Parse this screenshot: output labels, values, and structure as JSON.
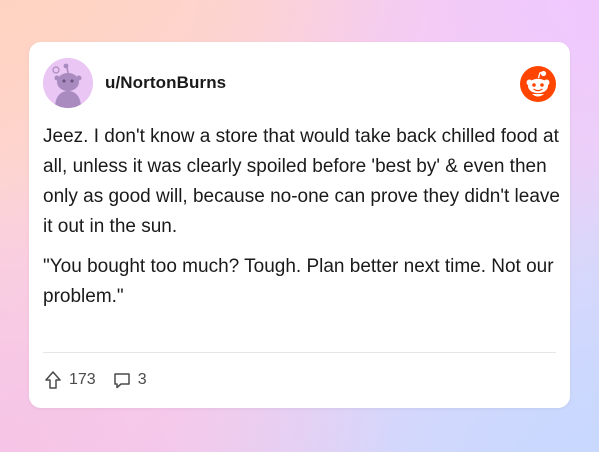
{
  "post": {
    "username": "u/NortonBurns",
    "paragraphs": [
      "Jeez. I don't know a store that would take back chilled food at all, unless it was clearly spoiled before 'best by' & even then only as good will, because no-one can prove they didn't leave it out in the sun.",
      "\"You bought too much? Tough. Plan better next time. Not our problem.\""
    ],
    "upvotes": "173",
    "comments": "3"
  },
  "icons": {
    "avatar": "snoo-avatar-icon",
    "logo": "reddit-logo-icon",
    "upvote": "upvote-arrow-icon",
    "comment": "comment-bubble-icon"
  },
  "colors": {
    "reddit_orange": "#ff4500",
    "avatar_bg": "#e9c6f3",
    "avatar_snoo": "#a98bc0"
  }
}
